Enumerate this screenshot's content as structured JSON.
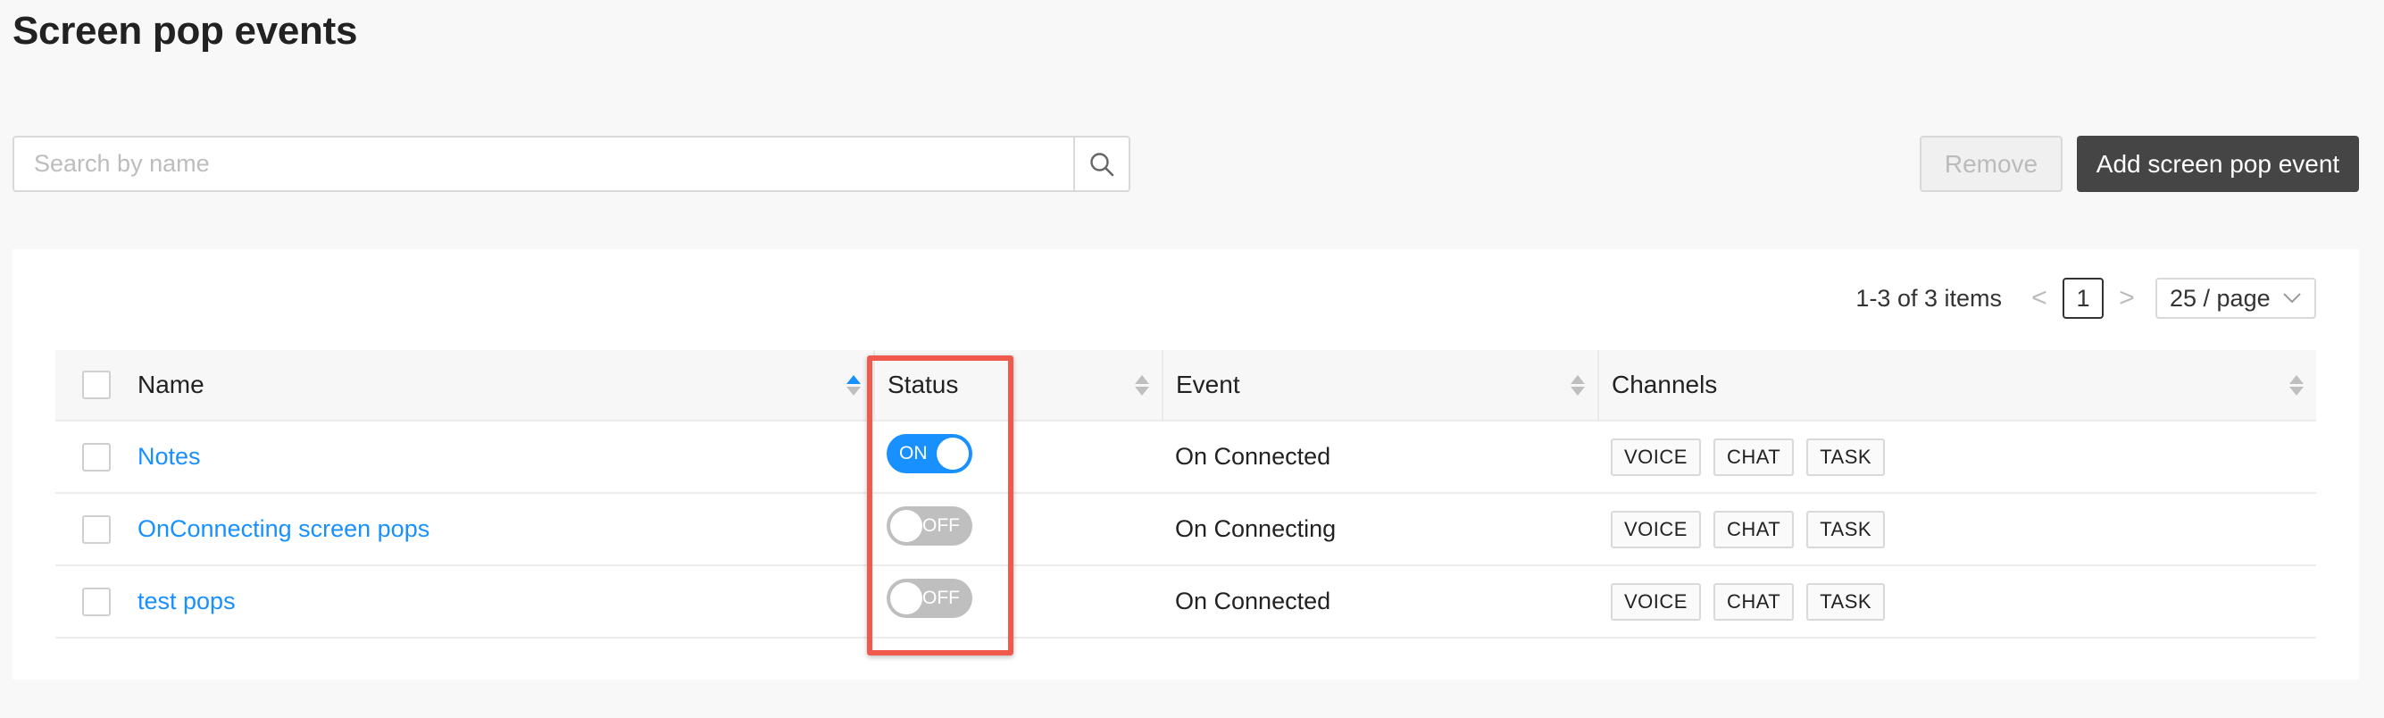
{
  "page": {
    "title": "Screen pop events"
  },
  "search": {
    "placeholder": "Search by name",
    "icon": "search-icon"
  },
  "actions": {
    "remove_label": "Remove",
    "add_label": "Add screen pop event"
  },
  "pagination": {
    "total_text": "1-3 of 3 items",
    "prev": "<",
    "current_page": "1",
    "next": ">",
    "page_size": "25 / page",
    "page_size_icon": "chevron-down-icon"
  },
  "table": {
    "columns": {
      "name": "Name",
      "status": "Status",
      "event": "Event",
      "channels": "Channels"
    },
    "sort": {
      "name": "ascending"
    },
    "rows": [
      {
        "name": "Notes",
        "status": "ON",
        "event": "On Connected",
        "channels": [
          "VOICE",
          "CHAT",
          "TASK"
        ]
      },
      {
        "name": "OnConnecting screen pops",
        "status": "OFF",
        "event": "On Connecting",
        "channels": [
          "VOICE",
          "CHAT",
          "TASK"
        ]
      },
      {
        "name": "test pops",
        "status": "OFF",
        "event": "On Connected",
        "channels": [
          "VOICE",
          "CHAT",
          "TASK"
        ]
      }
    ]
  },
  "colors": {
    "accent": "#1890ff",
    "toggle_off": "#bfbfbf",
    "primary_button": "#454545",
    "highlight": "#ef5a4c"
  }
}
